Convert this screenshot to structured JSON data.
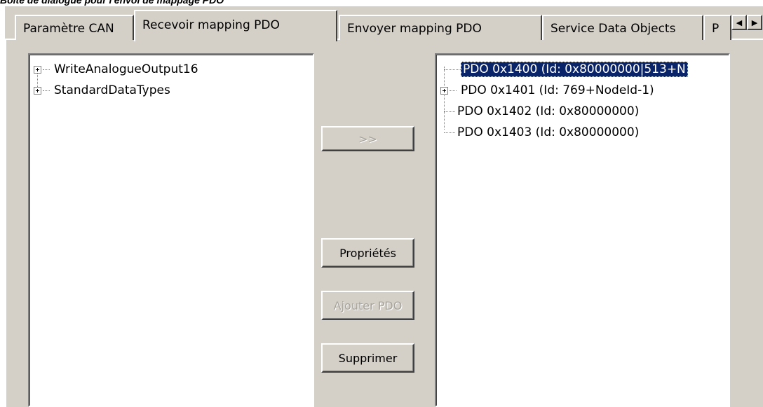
{
  "caption": "Boîte de dialogue pour l'envoi de mappage PDO",
  "tabs": [
    {
      "label": "Paramètre CAN",
      "active": false
    },
    {
      "label": "Recevoir mapping PDO",
      "active": true
    },
    {
      "label": "Envoyer mapping PDO",
      "active": false
    },
    {
      "label": "Service Data Objects",
      "active": false
    },
    {
      "label": "P",
      "active": false
    }
  ],
  "tab_scroll": {
    "left_icon": "arrow-left-icon",
    "right_icon": "arrow-right-icon"
  },
  "left_tree": {
    "items": [
      {
        "label": "WriteAnalogueOutput16",
        "expandable": true
      },
      {
        "label": "StandardDataTypes",
        "expandable": true
      }
    ]
  },
  "buttons": {
    "add_arrow": ">>",
    "properties": "Propriétés",
    "add_pdo": "Ajouter PDO",
    "delete": "Supprimer"
  },
  "right_tree": {
    "items": [
      {
        "label": "PDO 0x1400 (Id: 0x80000000|513+N",
        "selected": true,
        "expandable": false
      },
      {
        "label": "PDO 0x1401 (Id: 769+NodeId-1)",
        "selected": false,
        "expandable": true
      },
      {
        "label": "PDO 0x1402 (Id: 0x80000000)",
        "selected": false,
        "expandable": false
      },
      {
        "label": "PDO 0x1403 (Id: 0x80000000)",
        "selected": false,
        "expandable": false
      }
    ]
  },
  "colors": {
    "dialog_bg": "#d4d0c8",
    "selection_bg": "#0a246a",
    "disabled_text": "#a6a39b"
  }
}
